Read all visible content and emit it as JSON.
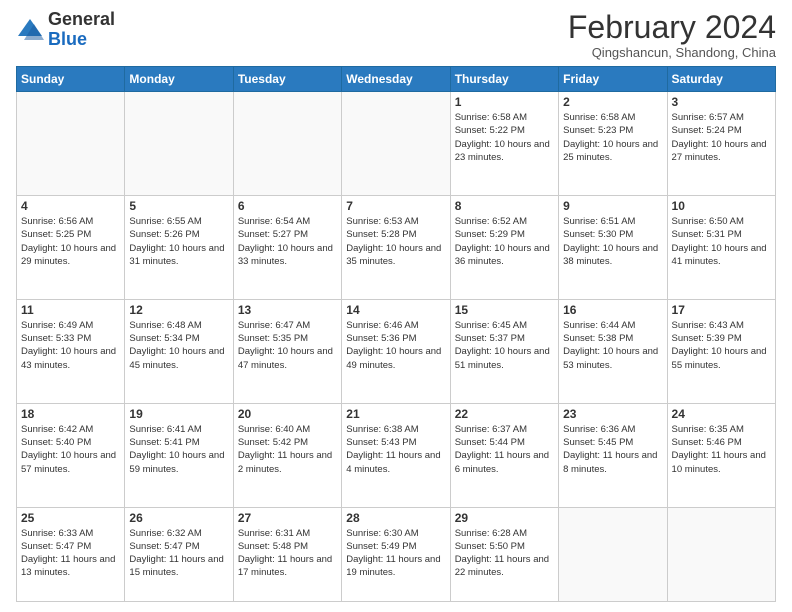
{
  "header": {
    "logo_general": "General",
    "logo_blue": "Blue",
    "month_title": "February 2024",
    "location": "Qingshancun, Shandong, China"
  },
  "days_of_week": [
    "Sunday",
    "Monday",
    "Tuesday",
    "Wednesday",
    "Thursday",
    "Friday",
    "Saturday"
  ],
  "weeks": [
    [
      {
        "day": "",
        "info": ""
      },
      {
        "day": "",
        "info": ""
      },
      {
        "day": "",
        "info": ""
      },
      {
        "day": "",
        "info": ""
      },
      {
        "day": "1",
        "info": "Sunrise: 6:58 AM\nSunset: 5:22 PM\nDaylight: 10 hours\nand 23 minutes."
      },
      {
        "day": "2",
        "info": "Sunrise: 6:58 AM\nSunset: 5:23 PM\nDaylight: 10 hours\nand 25 minutes."
      },
      {
        "day": "3",
        "info": "Sunrise: 6:57 AM\nSunset: 5:24 PM\nDaylight: 10 hours\nand 27 minutes."
      }
    ],
    [
      {
        "day": "4",
        "info": "Sunrise: 6:56 AM\nSunset: 5:25 PM\nDaylight: 10 hours\nand 29 minutes."
      },
      {
        "day": "5",
        "info": "Sunrise: 6:55 AM\nSunset: 5:26 PM\nDaylight: 10 hours\nand 31 minutes."
      },
      {
        "day": "6",
        "info": "Sunrise: 6:54 AM\nSunset: 5:27 PM\nDaylight: 10 hours\nand 33 minutes."
      },
      {
        "day": "7",
        "info": "Sunrise: 6:53 AM\nSunset: 5:28 PM\nDaylight: 10 hours\nand 35 minutes."
      },
      {
        "day": "8",
        "info": "Sunrise: 6:52 AM\nSunset: 5:29 PM\nDaylight: 10 hours\nand 36 minutes."
      },
      {
        "day": "9",
        "info": "Sunrise: 6:51 AM\nSunset: 5:30 PM\nDaylight: 10 hours\nand 38 minutes."
      },
      {
        "day": "10",
        "info": "Sunrise: 6:50 AM\nSunset: 5:31 PM\nDaylight: 10 hours\nand 41 minutes."
      }
    ],
    [
      {
        "day": "11",
        "info": "Sunrise: 6:49 AM\nSunset: 5:33 PM\nDaylight: 10 hours\nand 43 minutes."
      },
      {
        "day": "12",
        "info": "Sunrise: 6:48 AM\nSunset: 5:34 PM\nDaylight: 10 hours\nand 45 minutes."
      },
      {
        "day": "13",
        "info": "Sunrise: 6:47 AM\nSunset: 5:35 PM\nDaylight: 10 hours\nand 47 minutes."
      },
      {
        "day": "14",
        "info": "Sunrise: 6:46 AM\nSunset: 5:36 PM\nDaylight: 10 hours\nand 49 minutes."
      },
      {
        "day": "15",
        "info": "Sunrise: 6:45 AM\nSunset: 5:37 PM\nDaylight: 10 hours\nand 51 minutes."
      },
      {
        "day": "16",
        "info": "Sunrise: 6:44 AM\nSunset: 5:38 PM\nDaylight: 10 hours\nand 53 minutes."
      },
      {
        "day": "17",
        "info": "Sunrise: 6:43 AM\nSunset: 5:39 PM\nDaylight: 10 hours\nand 55 minutes."
      }
    ],
    [
      {
        "day": "18",
        "info": "Sunrise: 6:42 AM\nSunset: 5:40 PM\nDaylight: 10 hours\nand 57 minutes."
      },
      {
        "day": "19",
        "info": "Sunrise: 6:41 AM\nSunset: 5:41 PM\nDaylight: 10 hours\nand 59 minutes."
      },
      {
        "day": "20",
        "info": "Sunrise: 6:40 AM\nSunset: 5:42 PM\nDaylight: 11 hours\nand 2 minutes."
      },
      {
        "day": "21",
        "info": "Sunrise: 6:38 AM\nSunset: 5:43 PM\nDaylight: 11 hours\nand 4 minutes."
      },
      {
        "day": "22",
        "info": "Sunrise: 6:37 AM\nSunset: 5:44 PM\nDaylight: 11 hours\nand 6 minutes."
      },
      {
        "day": "23",
        "info": "Sunrise: 6:36 AM\nSunset: 5:45 PM\nDaylight: 11 hours\nand 8 minutes."
      },
      {
        "day": "24",
        "info": "Sunrise: 6:35 AM\nSunset: 5:46 PM\nDaylight: 11 hours\nand 10 minutes."
      }
    ],
    [
      {
        "day": "25",
        "info": "Sunrise: 6:33 AM\nSunset: 5:47 PM\nDaylight: 11 hours\nand 13 minutes."
      },
      {
        "day": "26",
        "info": "Sunrise: 6:32 AM\nSunset: 5:47 PM\nDaylight: 11 hours\nand 15 minutes."
      },
      {
        "day": "27",
        "info": "Sunrise: 6:31 AM\nSunset: 5:48 PM\nDaylight: 11 hours\nand 17 minutes."
      },
      {
        "day": "28",
        "info": "Sunrise: 6:30 AM\nSunset: 5:49 PM\nDaylight: 11 hours\nand 19 minutes."
      },
      {
        "day": "29",
        "info": "Sunrise: 6:28 AM\nSunset: 5:50 PM\nDaylight: 11 hours\nand 22 minutes."
      },
      {
        "day": "",
        "info": ""
      },
      {
        "day": "",
        "info": ""
      }
    ]
  ]
}
